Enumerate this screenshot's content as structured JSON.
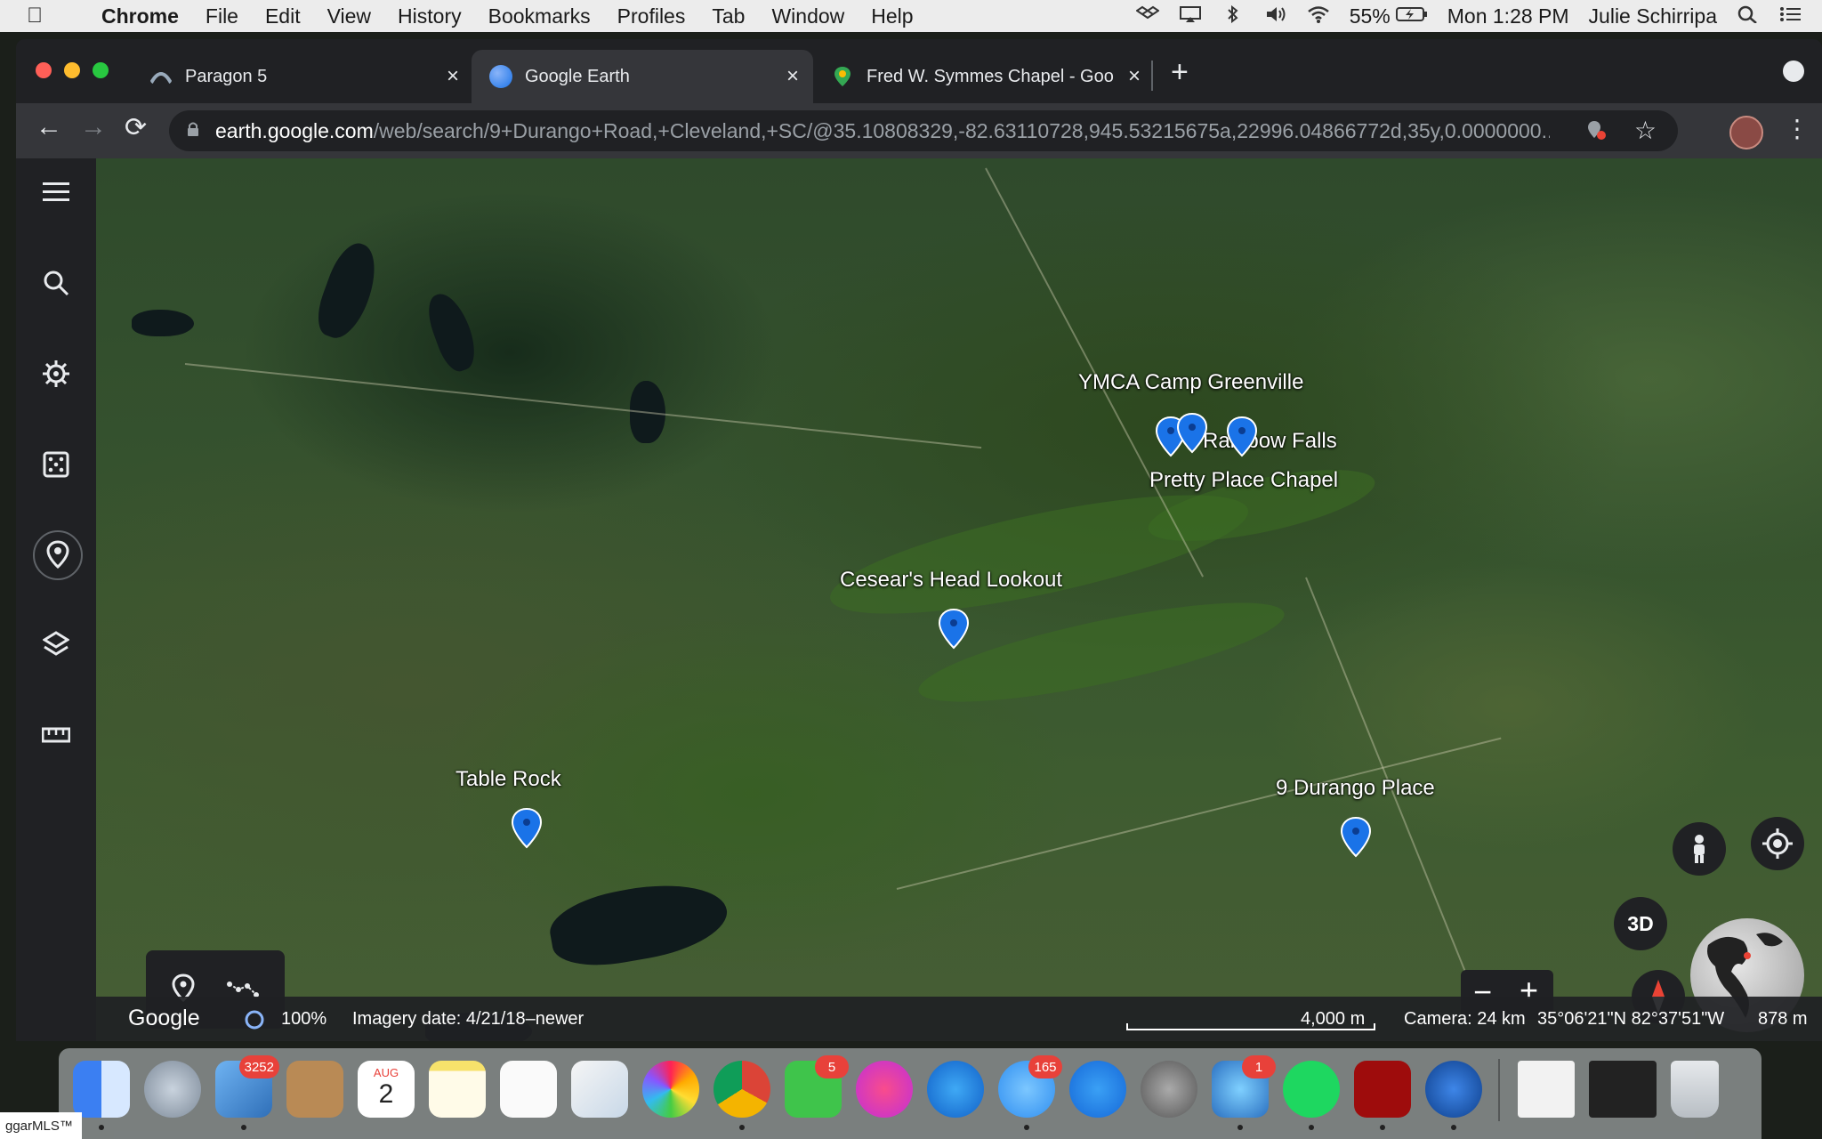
{
  "menubar": {
    "app": "Chrome",
    "items": [
      "File",
      "Edit",
      "View",
      "History",
      "Bookmarks",
      "Profiles",
      "Tab",
      "Window",
      "Help"
    ],
    "battery": "55%",
    "clock": "Mon 1:28 PM",
    "user": "Julie Schirripa"
  },
  "tabs": [
    {
      "title": "Paragon 5",
      "active": false
    },
    {
      "title": "Google Earth",
      "active": true
    },
    {
      "title": "Fred W. Symmes Chapel - Goo",
      "active": false
    }
  ],
  "address": {
    "host": "earth.google.com",
    "path": "/web/search/9+Durango+Road,+Cleveland,+SC/@35.10808329,-82.63110728,945.53215675a,22996.04866772d,35y,0.0000000..."
  },
  "map": {
    "places": [
      {
        "name": "YMCA Camp Greenville"
      },
      {
        "name": "Rainbow Falls"
      },
      {
        "name": "Pretty Place Chapel"
      },
      {
        "name": "Cesear's Head Lookout"
      },
      {
        "name": "Table Rock"
      },
      {
        "name": "9 Durango Place"
      }
    ],
    "button_3d": "3D"
  },
  "status": {
    "brand": "Google",
    "load": "100%",
    "imagery": "Imagery date: 4/21/18–newer",
    "scale": "4,000 m",
    "camera": "Camera: 24 km",
    "coords": "35°06'21\"N 82°37'51\"W",
    "elevation": "878 m"
  },
  "dock": {
    "badges": {
      "mail": "3252",
      "calendar_month": "AUG",
      "calendar_day": "2",
      "facetime": "5",
      "messages": "165",
      "network": "1"
    }
  },
  "watermark": "ggarMLS™"
}
